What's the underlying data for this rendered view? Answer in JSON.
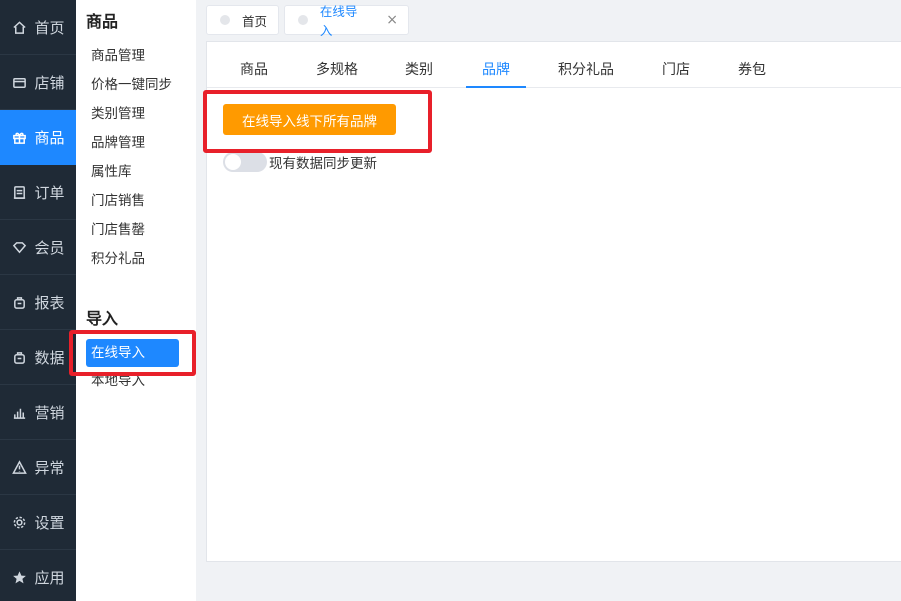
{
  "nav": {
    "items": [
      {
        "label": "首页",
        "icon": "home-icon"
      },
      {
        "label": "店铺",
        "icon": "store-icon"
      },
      {
        "label": "商品",
        "icon": "gift-icon",
        "active": true
      },
      {
        "label": "订单",
        "icon": "order-icon"
      },
      {
        "label": "会员",
        "icon": "member-icon"
      },
      {
        "label": "报表",
        "icon": "report-icon"
      },
      {
        "label": "数据",
        "icon": "data-icon"
      },
      {
        "label": "营销",
        "icon": "marketing-icon"
      },
      {
        "label": "异常",
        "icon": "warning-icon"
      },
      {
        "label": "设置",
        "icon": "gear-icon"
      },
      {
        "label": "应用",
        "icon": "star-icon"
      }
    ]
  },
  "submenu": {
    "section1_title": "商品",
    "section1_items": [
      "商品管理",
      "价格一键同步",
      "类别管理",
      "品牌管理",
      "属性库",
      "门店销售",
      "门店售罄",
      "积分礼品"
    ],
    "section2_title": "导入",
    "section2_active": "在线导入",
    "section2_other": "本地导入"
  },
  "page_tabs": {
    "home": "首页",
    "current": "在线导入",
    "close": "×"
  },
  "inner_tabs": [
    "商品",
    "多规格",
    "类别",
    "品牌",
    "积分礼品",
    "门店",
    "券包"
  ],
  "inner_tab_active": "品牌",
  "main": {
    "import_button": "在线导入线下所有品牌",
    "switch_label": "现有数据同步更新",
    "switch_on": false
  },
  "colors": {
    "nav_bg": "#1f2a36",
    "accent": "#1e88ff",
    "button_orange": "#ff9a00",
    "highlight_red": "#e8202a"
  }
}
